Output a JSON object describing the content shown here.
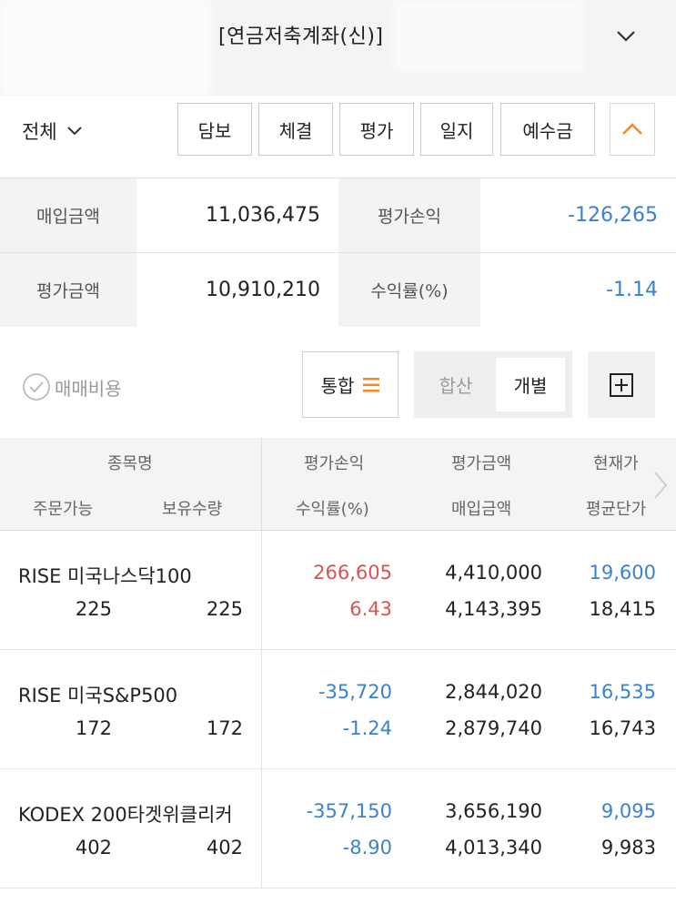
{
  "header": {
    "account_title": "[연금저축계좌(신)]"
  },
  "filter": {
    "scope_label": "전체",
    "tabs": [
      "담보",
      "체결",
      "평가",
      "일지",
      "예수금"
    ]
  },
  "summary": {
    "purchase_label": "매입금액",
    "purchase_value": "11,036,475",
    "pnl_label": "평가손익",
    "pnl_value": "-126,265",
    "eval_label": "평가금액",
    "eval_value": "10,910,210",
    "return_label": "수익률(%)",
    "return_value": "-1.14"
  },
  "options": {
    "fee_label": "매매비용",
    "merge_label": "통합",
    "seg_total": "합산",
    "seg_individual": "개별"
  },
  "table": {
    "headers": {
      "name": "종목명",
      "orderable": "주문가능",
      "holding": "보유수량",
      "pnl": "평가손익",
      "return": "수익률(%)",
      "eval": "평가금액",
      "purchase": "매입금액",
      "price": "현재가",
      "avg": "평균단가"
    },
    "rows": [
      {
        "name": "RISE 미국나스닥100",
        "orderable": "225",
        "holding": "225",
        "pnl": "266,605",
        "return": "6.43",
        "eval": "4,410,000",
        "purchase": "4,143,395",
        "price": "19,600",
        "avg": "18,415"
      },
      {
        "name": "RISE 미국S&P500",
        "orderable": "172",
        "holding": "172",
        "pnl": "-35,720",
        "return": "-1.24",
        "eval": "2,844,020",
        "purchase": "2,879,740",
        "price": "16,535",
        "avg": "16,743"
      },
      {
        "name": "KODEX 200타겟위클리커",
        "orderable": "402",
        "holding": "402",
        "pnl": "-357,150",
        "return": "-8.90",
        "eval": "3,656,190",
        "purchase": "4,013,340",
        "price": "9,095",
        "avg": "9,983"
      }
    ]
  },
  "colors": {
    "positive": "#d9534f",
    "negative": "#3a82cf",
    "accent_orange": "#f08a24"
  },
  "icons": {
    "header_dropdown": "chevron-down-icon",
    "collapse": "chevron-up-icon",
    "fee_check": "check-circle-icon",
    "merge": "menu-lines-icon",
    "add_view": "plus-square-icon",
    "table_next": "chevron-right-icon"
  }
}
